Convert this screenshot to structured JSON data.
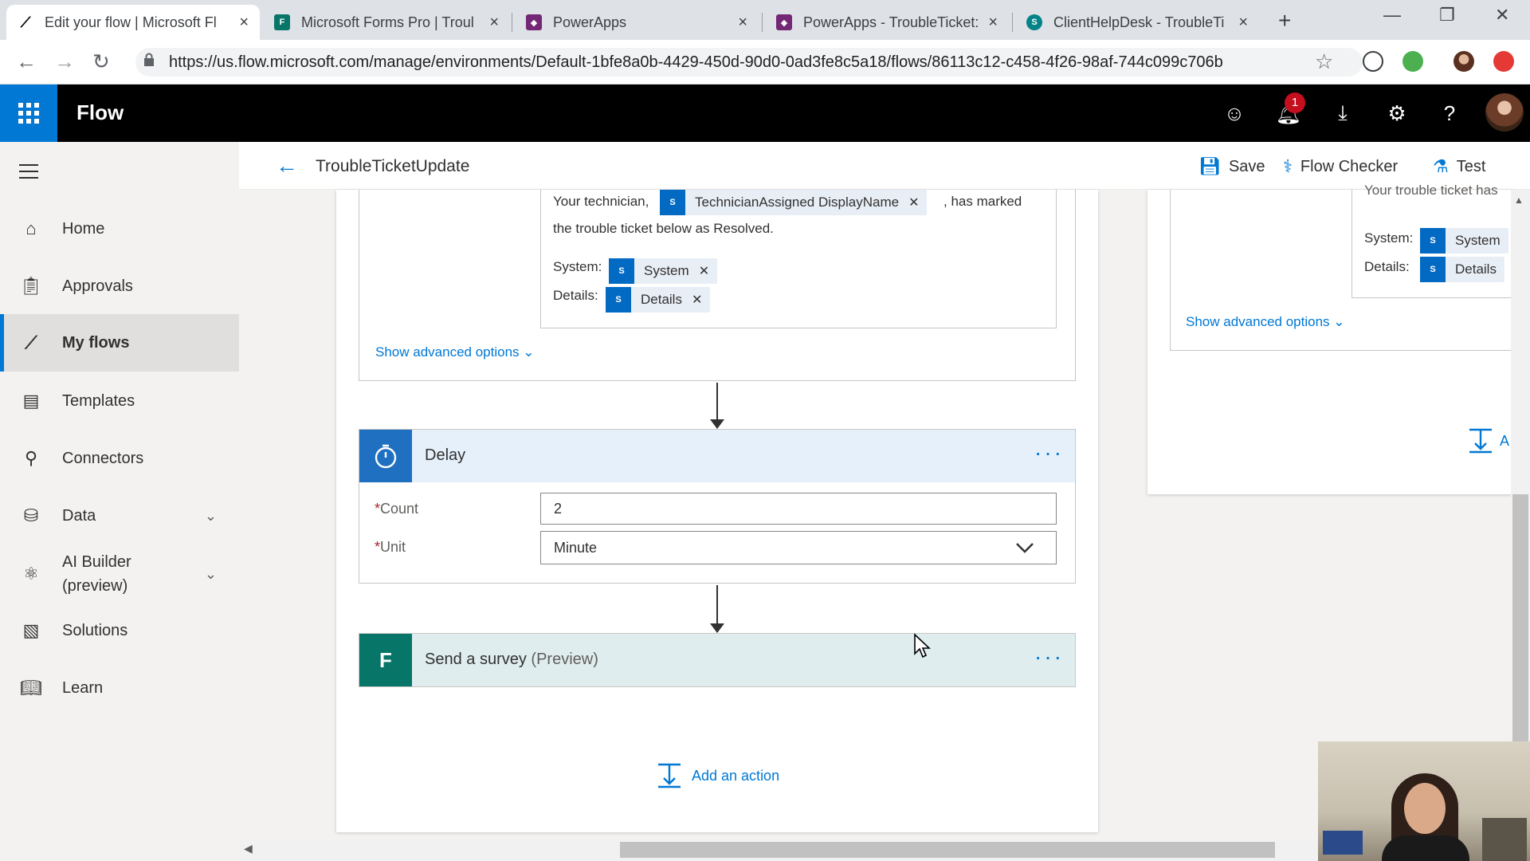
{
  "browser": {
    "tabs": [
      {
        "label": "Edit your flow | Microsoft Fl",
        "active": true
      },
      {
        "label": "Microsoft Forms Pro | Troul",
        "active": false
      },
      {
        "label": "PowerApps",
        "active": false
      },
      {
        "label": "PowerApps - TroubleTicket:",
        "active": false
      },
      {
        "label": "ClientHelpDesk - TroubleTi",
        "active": false
      }
    ],
    "url": "https://us.flow.microsoft.com/manage/environments/Default-1bfe8a0b-4429-450d-90d0-0ad3fe8c5a18/flows/86113c12-c458-4f26-98af-744c099c706b"
  },
  "header": {
    "brand": "Flow",
    "notification_count": "1"
  },
  "nav": {
    "items": [
      {
        "label": "Home"
      },
      {
        "label": "Approvals"
      },
      {
        "label": "My flows"
      },
      {
        "label": "Templates"
      },
      {
        "label": "Connectors"
      },
      {
        "label": "Data"
      },
      {
        "label": "AI Builder",
        "label2": "(preview)"
      },
      {
        "label": "Solutions"
      },
      {
        "label": "Learn"
      }
    ]
  },
  "commandbar": {
    "flow_name": "TroubleTicketUpdate",
    "save": "Save",
    "flow_checker": "Flow Checker",
    "test": "Test"
  },
  "email_body": {
    "line1_prefix": "Your technician,",
    "technician_token": "TechnicianAssigned DisplayName",
    "line1_suffix": ", has marked",
    "line2": "the trouble ticket below as Resolved.",
    "system_label": "System:",
    "system_token": "System",
    "details_label": "Details:",
    "details_token": "Details",
    "show_advanced": "Show advanced options"
  },
  "delay": {
    "title": "Delay",
    "count_label": "Count",
    "count_value": "2",
    "unit_label": "Unit",
    "unit_value": "Minute",
    "required_mark": "*"
  },
  "survey": {
    "title": "Send a survey",
    "suffix": "(Preview)"
  },
  "add_action": "Add an action",
  "right_card": {
    "partial_text": "Your trouble ticket has",
    "system_label": "System:",
    "system_token": "System",
    "details_label": "Details:",
    "details_token": "Details",
    "show_advanced": "Show advanced options",
    "add_partial": "A"
  },
  "colors": {
    "accent": "#0078d4",
    "delay_header": "#e5f0fb",
    "survey_header": "#dfedee",
    "forms_green": "#077568",
    "header_bg": "#000000"
  }
}
